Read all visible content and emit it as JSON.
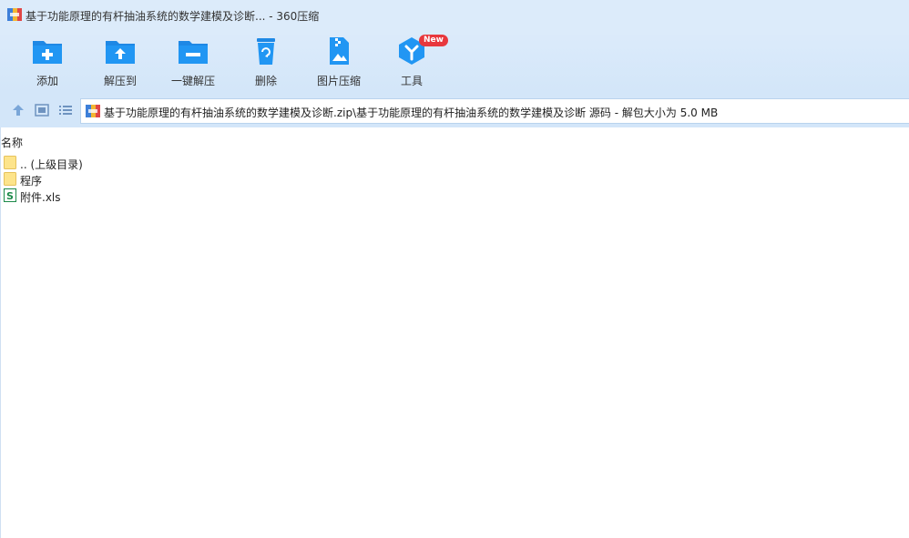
{
  "window": {
    "title": "基于功能原理的有杆抽油系统的数学建模及诊断... - 360压缩"
  },
  "toolbar": {
    "items": [
      {
        "label": "添加",
        "icon": "add-folder-icon"
      },
      {
        "label": "解压到",
        "icon": "extract-to-icon"
      },
      {
        "label": "一键解压",
        "icon": "one-click-extract-icon"
      },
      {
        "label": "删除",
        "icon": "trash-icon"
      },
      {
        "label": "图片压缩",
        "icon": "image-compress-icon"
      },
      {
        "label": "工具",
        "icon": "tools-icon",
        "badge": "New"
      }
    ]
  },
  "navbar": {
    "path": "基于功能原理的有杆抽油系统的数学建模及诊断.zip\\基于功能原理的有杆抽油系统的数学建模及诊断 源码 - 解包大小为 5.0 MB"
  },
  "filelist": {
    "header": "名称",
    "items": [
      {
        "name": ".. (上级目录)",
        "type": "folder"
      },
      {
        "name": "程序",
        "type": "folder"
      },
      {
        "name": "附件.xls",
        "type": "spreadsheet"
      }
    ]
  },
  "colors": {
    "accent": "#1e88e5",
    "toolbar_bg": "#d3e6f9",
    "badge": "#e8383d"
  }
}
